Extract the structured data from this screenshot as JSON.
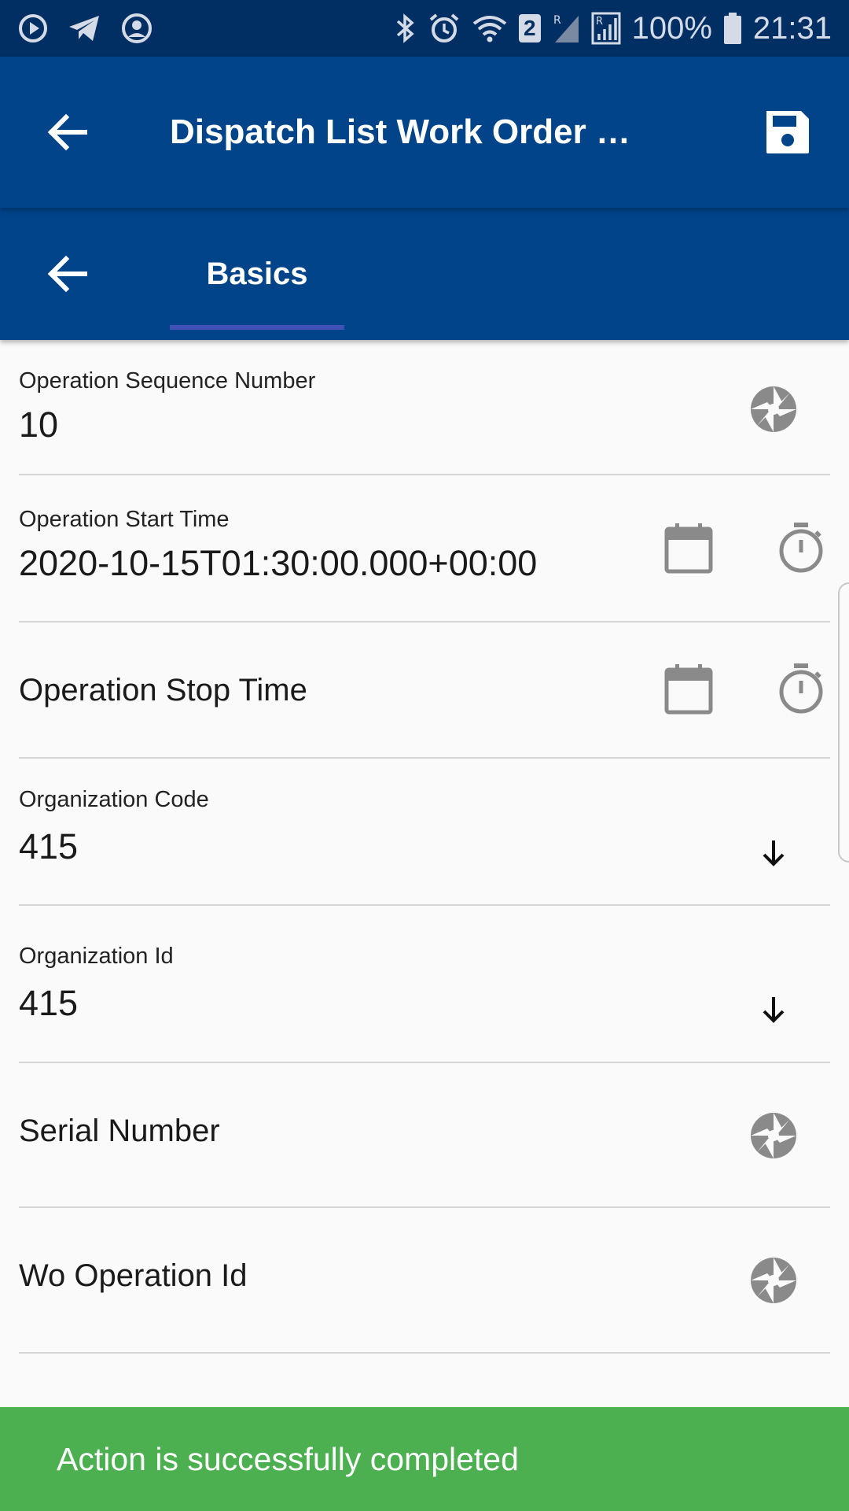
{
  "status_bar": {
    "battery": "100%",
    "time": "21:31",
    "sim_badge": "2"
  },
  "app_bar": {
    "title": "Dispatch List Work Order …"
  },
  "tabs": [
    {
      "label": "Basics",
      "active": true
    }
  ],
  "fields": [
    {
      "label": "Operation Sequence Number",
      "value": "10",
      "icons": [
        "aperture-icon"
      ]
    },
    {
      "label": "Operation Start Time",
      "value": "2020-10-15T01:30:00.000+00:00",
      "icons": [
        "calendar-icon",
        "stopwatch-icon"
      ]
    },
    {
      "label": "Operation Stop Time",
      "value": "",
      "icons": [
        "calendar-icon",
        "stopwatch-icon"
      ]
    },
    {
      "label": "Organization Code",
      "value": "415",
      "icons": [
        "arrow-down-icon"
      ]
    },
    {
      "label": "Organization Id",
      "value": "415",
      "icons": [
        "arrow-down-icon"
      ]
    },
    {
      "label": "Serial Number",
      "value": "",
      "icons": [
        "aperture-icon"
      ]
    },
    {
      "label": "Wo Operation Id",
      "value": "",
      "icons": [
        "aperture-icon"
      ]
    }
  ],
  "snackbar": {
    "message": "Action is successfully completed",
    "color": "#4caf50"
  },
  "colors": {
    "primary": "#014489",
    "status_bar": "#012f63",
    "tab_indicator": "#3f51b5",
    "icon_gray": "#8a8a8a"
  }
}
